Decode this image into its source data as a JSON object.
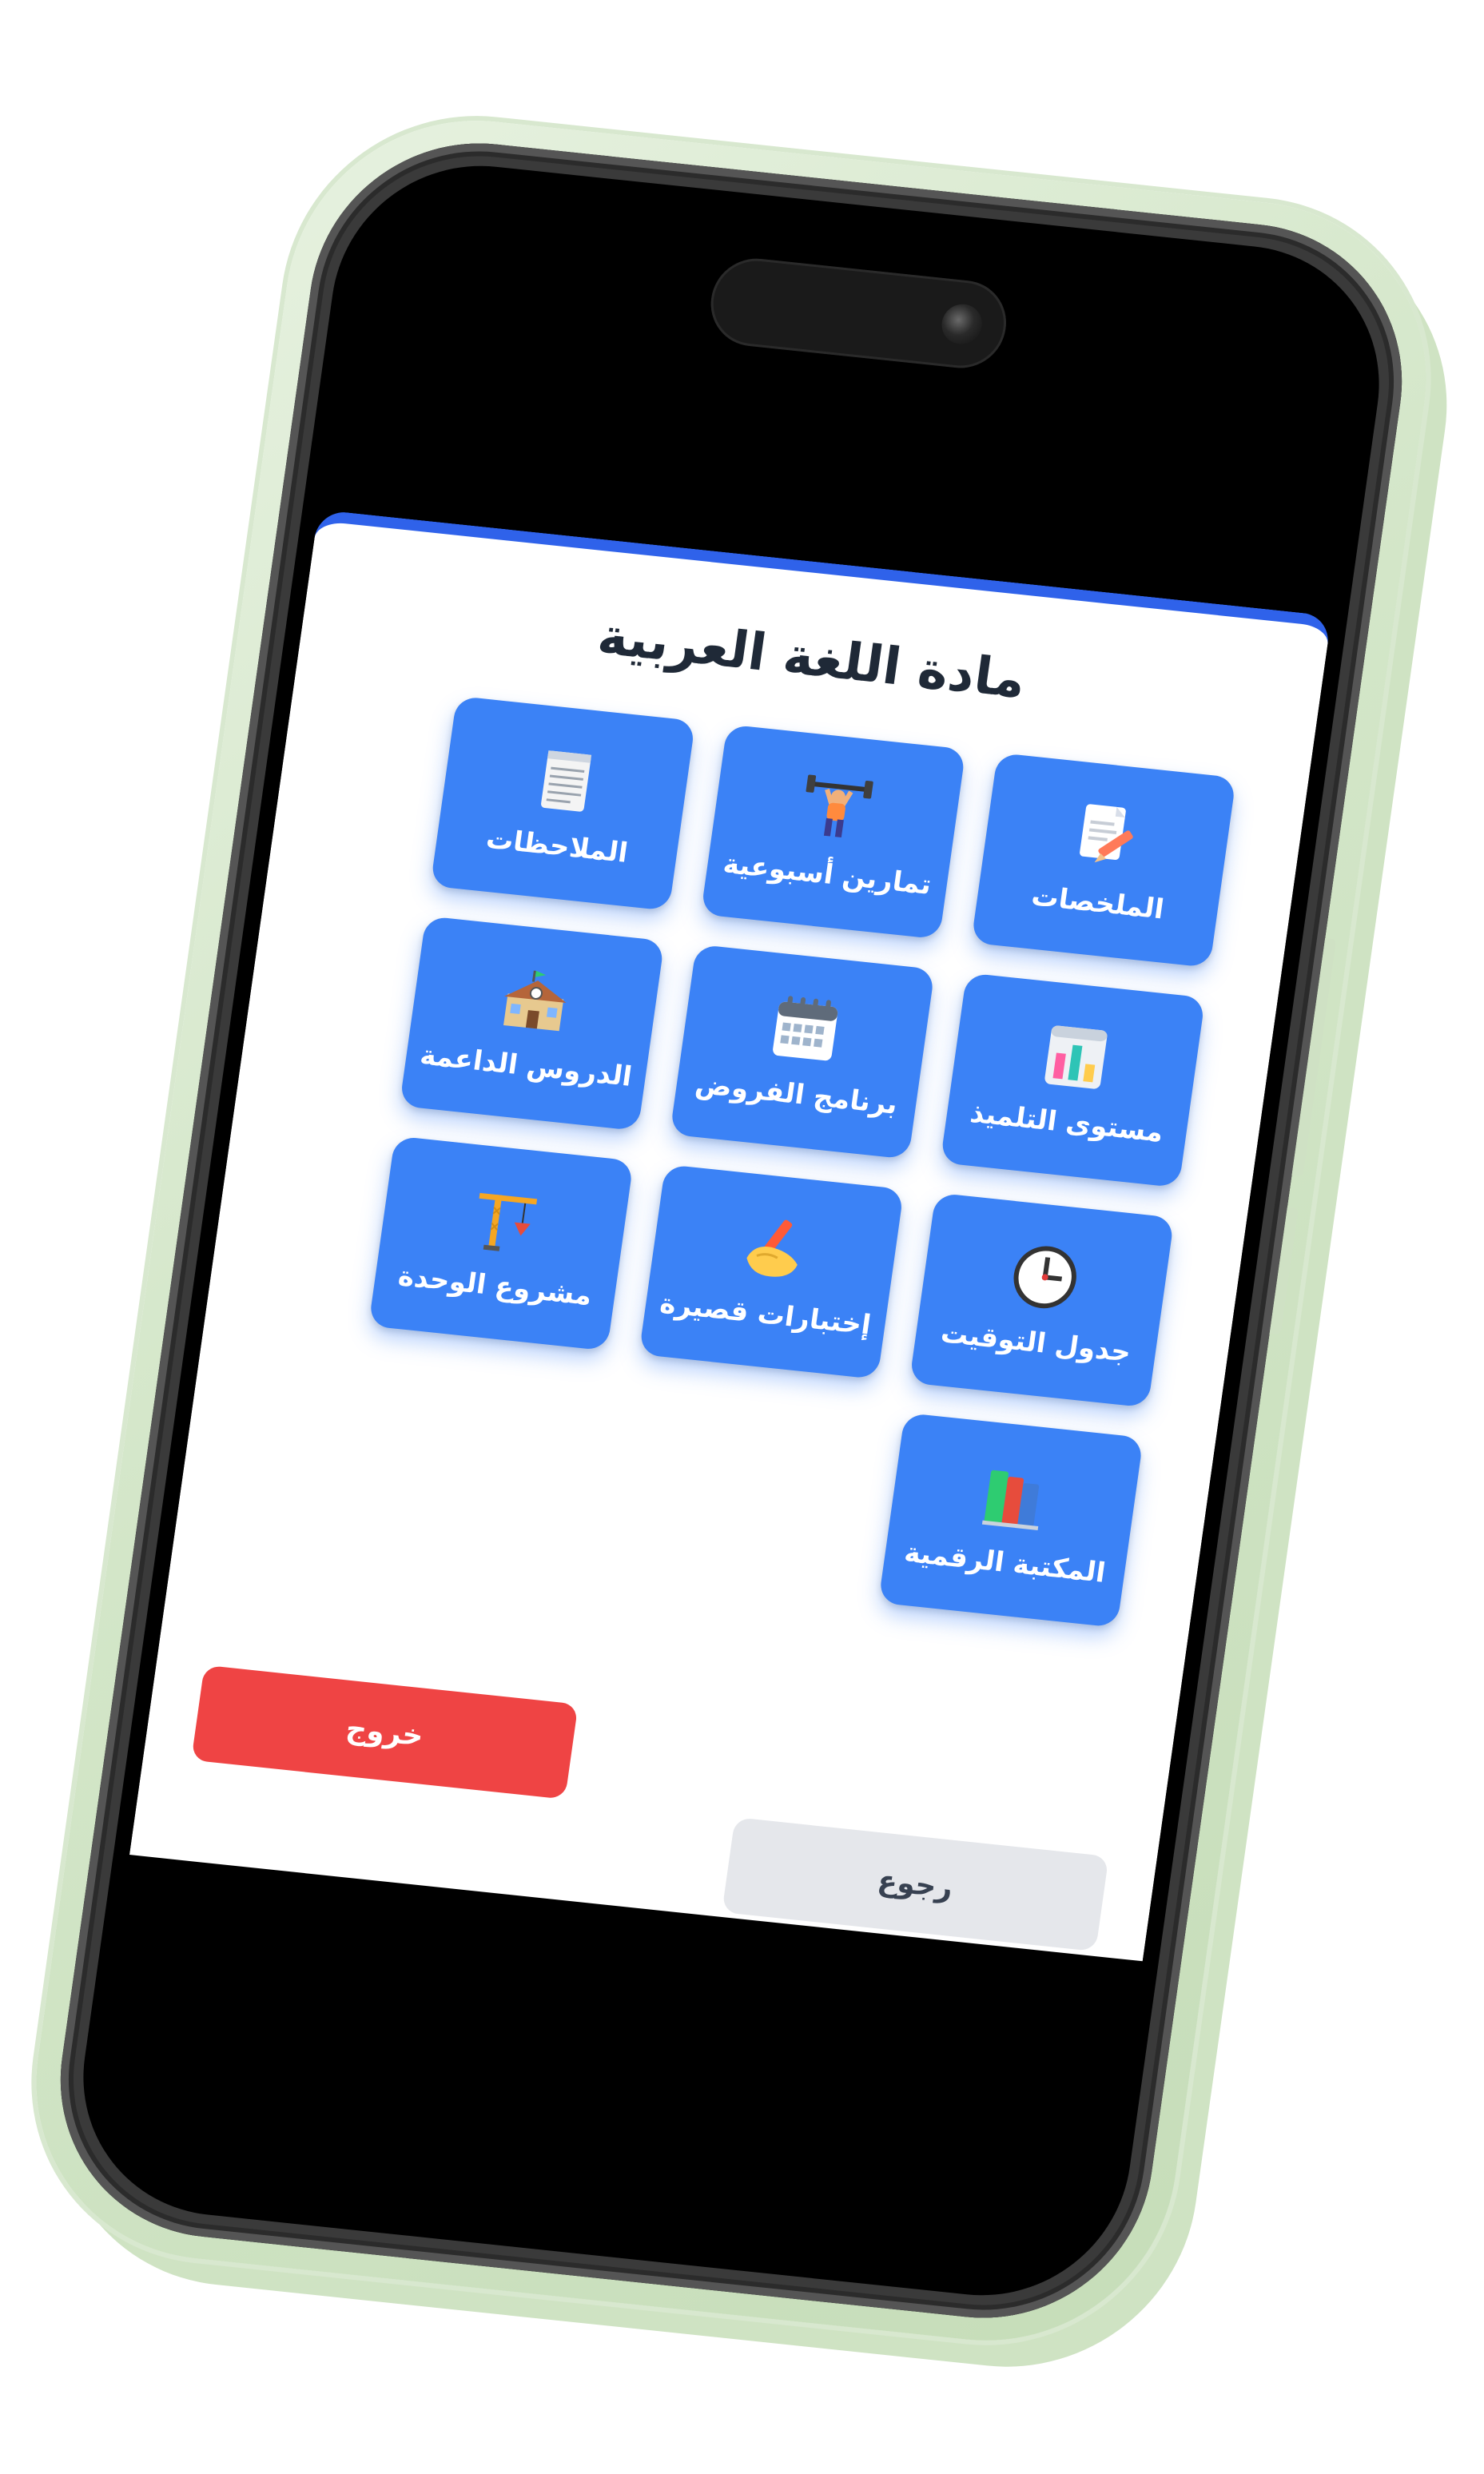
{
  "app": {
    "title": "مادة اللغة العربية",
    "accent_color": "#2f62ea",
    "card_color": "#3b82f6"
  },
  "tiles": [
    {
      "label": "الملخصات",
      "icon": "document-pencil-icon"
    },
    {
      "label": "تمارين أسبوعية",
      "icon": "weightlifter-icon"
    },
    {
      "label": "الملاحظات",
      "icon": "notepad-icon"
    },
    {
      "label": "مستوى التلميذ",
      "icon": "bar-chart-icon"
    },
    {
      "label": "برنامج الفروض",
      "icon": "calendar-icon"
    },
    {
      "label": "الدروس الداعمة",
      "icon": "school-building-icon"
    },
    {
      "label": "جدول التوقيت",
      "icon": "clock-icon"
    },
    {
      "label": "إختبارات قصيرة",
      "icon": "writing-hand-icon"
    },
    {
      "label": "مشروع الوحدة",
      "icon": "construction-crane-icon"
    },
    {
      "label": "المكتبة الرقمية",
      "icon": "books-icon"
    }
  ],
  "buttons": {
    "back_label": "رجوع",
    "exit_label": "خروج",
    "exit_color": "#ef4444"
  }
}
